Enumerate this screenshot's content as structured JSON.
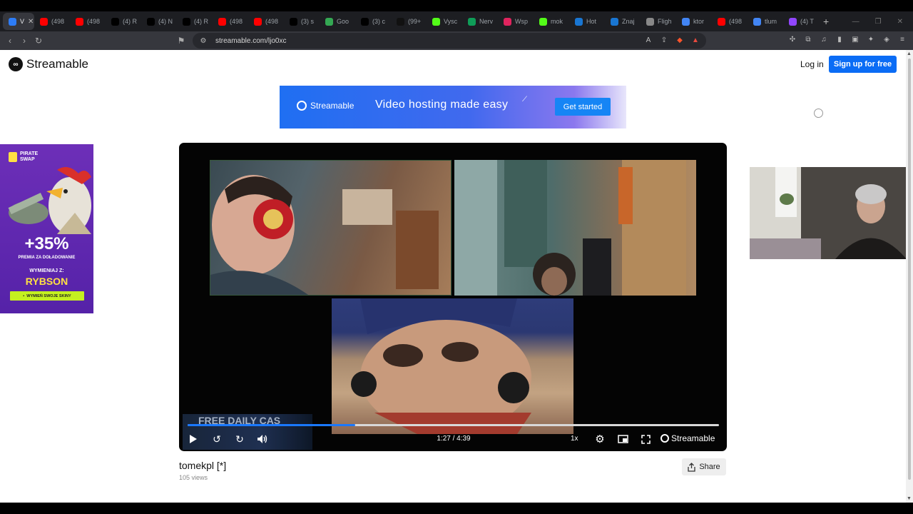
{
  "browser": {
    "tabs": [
      {
        "title": "V",
        "color": "#2d7cf6",
        "active": true
      },
      {
        "title": "(498",
        "color": "#ff0000"
      },
      {
        "title": "(498",
        "color": "#ff0000"
      },
      {
        "title": "(4) R",
        "color": "#000000"
      },
      {
        "title": "(4) N",
        "color": "#000000"
      },
      {
        "title": "(4) R",
        "color": "#000000"
      },
      {
        "title": "(498",
        "color": "#ff0000"
      },
      {
        "title": "(498",
        "color": "#ff0000"
      },
      {
        "title": "(3) s",
        "color": "#000000"
      },
      {
        "title": "Goo",
        "color": "#34a853"
      },
      {
        "title": "(3) c",
        "color": "#000000"
      },
      {
        "title": "(99+",
        "color": "#111111"
      },
      {
        "title": "Vysc",
        "color": "#53fc18"
      },
      {
        "title": "Nerv",
        "color": "#0f9d58"
      },
      {
        "title": "Wsp",
        "color": "#e0245e"
      },
      {
        "title": "mok",
        "color": "#53fc18"
      },
      {
        "title": "Hot",
        "color": "#1976d2"
      },
      {
        "title": "Znaj",
        "color": "#1976d2"
      },
      {
        "title": "Fligh",
        "color": "#888888"
      },
      {
        "title": "ktor",
        "color": "#4285f4"
      },
      {
        "title": "(498",
        "color": "#ff0000"
      },
      {
        "title": "tlum",
        "color": "#4285f4"
      },
      {
        "title": "(4) T",
        "color": "#9146ff"
      }
    ],
    "url": "streamable.com/ljo0xc"
  },
  "header": {
    "logo": "Streamable",
    "login": "Log in",
    "signup": "Sign up for free"
  },
  "banner": {
    "logo": "Streamable",
    "tagline": "Video hosting made easy",
    "cta": "Get started"
  },
  "ad": {
    "brand_line1": "PIRATE",
    "brand_line2": "SWAP",
    "percent": "+35%",
    "line1": "PREMIA ZA DOŁADOWANIE",
    "line2": "WYMIENIAJ Z:",
    "line3": "RYBSON",
    "button": "WYMIEŃ SWOJE SKINY"
  },
  "player": {
    "current_time": "1:27",
    "duration": "4:39",
    "time_display": "1:27 / 4:39",
    "progress": 0.315,
    "speed": "1x",
    "brand": "Streamable",
    "overlay_text": "FREE DAILY CAS"
  },
  "video": {
    "title": "tomekpl [*]",
    "views": "105 views",
    "share": "Share"
  }
}
